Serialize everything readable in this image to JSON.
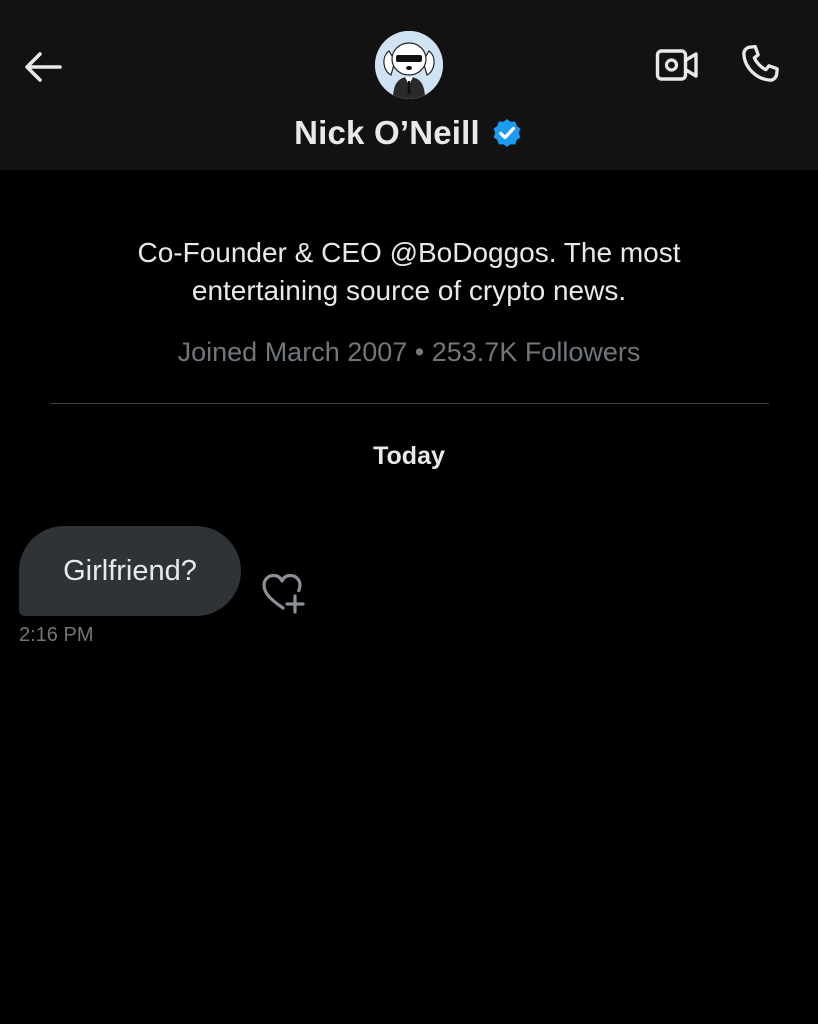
{
  "header": {
    "back_icon": "arrow-left-icon",
    "video_icon": "video-camera-icon",
    "call_icon": "phone-icon",
    "avatar_icon": "dog-avatar-icon",
    "name": "Nick O’Neill",
    "verified_icon": "verified-badge-icon",
    "verified_color": "#1d9bf0"
  },
  "profile": {
    "bio_line1": "Co-Founder & CEO @BoDoggos. The most",
    "bio_line2": "entertaining source of crypto news.",
    "joined": "Joined March 2007",
    "separator": " • ",
    "followers": "253.7K Followers"
  },
  "conversation": {
    "date_label": "Today",
    "messages": [
      {
        "text": "Girlfriend?",
        "time": "2:16 PM",
        "reaction_icon": "heart-plus-icon"
      }
    ]
  },
  "colors": {
    "background": "#000000",
    "header_bg": "#121212",
    "bubble_bg": "#2f3336",
    "text_primary": "#e7e9ea",
    "text_secondary": "#71767b",
    "accent": "#1d9bf0"
  }
}
